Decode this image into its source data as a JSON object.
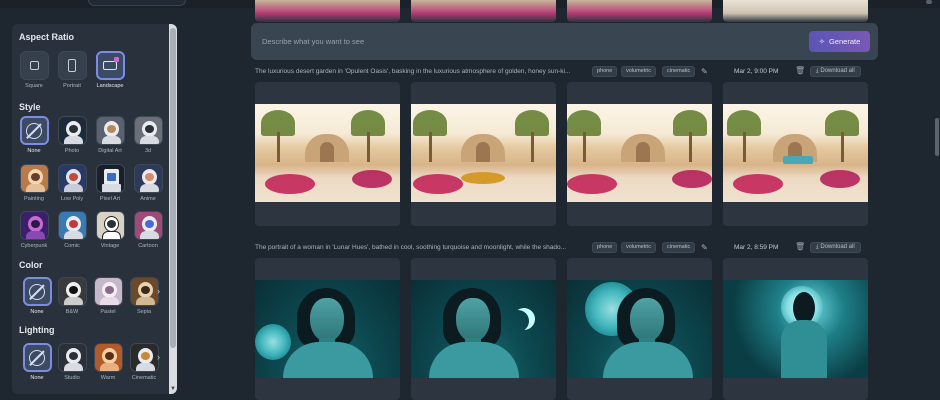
{
  "sidebar": {
    "sections": {
      "aspect_ratio": "Aspect Ratio",
      "style": "Style",
      "color": "Color",
      "lighting": "Lighting"
    },
    "aspect_options": [
      "Square",
      "Portrait",
      "Landscape"
    ],
    "aspect_selected": "Landscape",
    "style_options": [
      "None",
      "Photo",
      "Digital Art",
      "3d",
      "Painting",
      "Low Poly",
      "Pixel Art",
      "Anime",
      "Cyberpunk",
      "Comic",
      "Vintage",
      "Cartoon"
    ],
    "style_selected": "None",
    "color_options": [
      "None",
      "B&W",
      "Pastel",
      "Sepia"
    ],
    "color_selected": "None",
    "lighting_options": [
      "None",
      "Studio",
      "Warm",
      "Cinematic"
    ],
    "lighting_selected": "None"
  },
  "prompt": {
    "placeholder": "Describe what you want to see",
    "generate_label": "Generate"
  },
  "generations": [
    {
      "description": "The luxurious desert garden in 'Opulent Oasis', basking in the luxurious atmosphere of golden, honey sun-ki...",
      "tags": [
        "phone",
        "volumetric",
        "cinematic"
      ],
      "date": "Mar 2, 9:00 PM",
      "download_label": "Download all"
    },
    {
      "description": "The portrait of a woman in 'Lunar Hues', bathed in cool, soothing turquoise and moonlight, while the shado...",
      "tags": [
        "phone",
        "volumetric",
        "cinematic"
      ],
      "date": "Mar 2, 8:59 PM",
      "download_label": "Download all"
    }
  ],
  "icons": {
    "generate": "magic-wand-icon",
    "edit": "pencil-icon",
    "delete": "trash-icon",
    "download": "download-icon"
  },
  "colors": {
    "accent": "#7c8ce0",
    "generate_button": "#5a55b4",
    "background": "#1e2630",
    "panel": "#28313c"
  }
}
